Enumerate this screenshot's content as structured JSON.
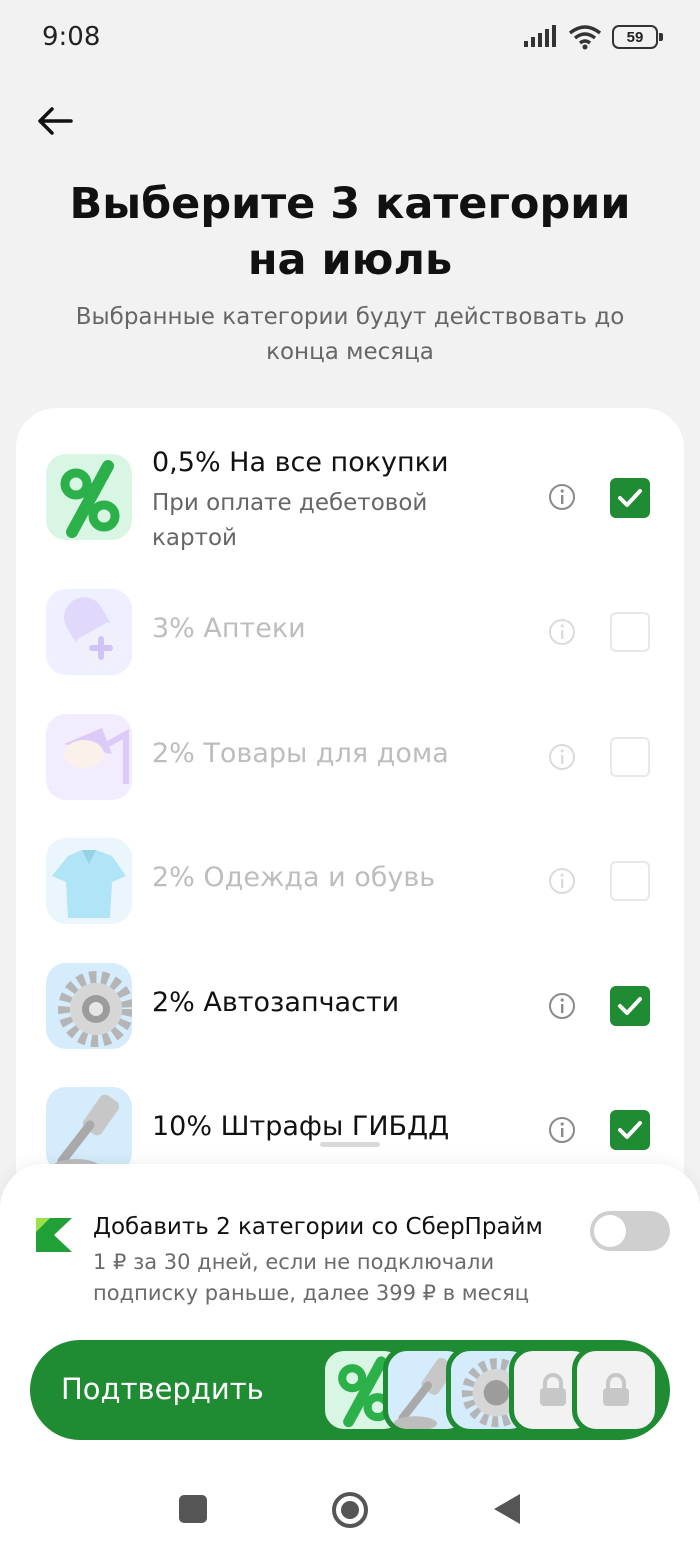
{
  "status": {
    "time": "9:08",
    "battery": "59"
  },
  "header": {
    "title_line1": "Выберите 3 категории",
    "title_line2": "на июль",
    "subtitle": "Выбранные категории будут действовать до конца месяца"
  },
  "categories": [
    {
      "label": "0,5% На все покупки",
      "sub": "При оплате дебетовой картой",
      "checked": true,
      "icon": "percent-icon"
    },
    {
      "label": "3% Аптеки",
      "checked": false,
      "icon": "pill-icon"
    },
    {
      "label": "2% Товары для дома",
      "checked": false,
      "icon": "lamp-icon"
    },
    {
      "label": "2% Одежда и обувь",
      "checked": false,
      "icon": "shirt-icon"
    },
    {
      "label": "2% Автозапчасти",
      "checked": true,
      "icon": "gear-icon"
    },
    {
      "label": "10% Штрафы ГИБДД",
      "checked": true,
      "icon": "gavel-icon"
    }
  ],
  "prime": {
    "title": "Добавить 2 категории со СберПрайм",
    "description": "1 ₽ за 30 дней, если не подключали подписку раньше, далее 399 ₽ в месяц",
    "enabled": false
  },
  "confirm": {
    "label": "Подтвердить"
  },
  "colors": {
    "accent": "#1f8b32",
    "background": "#f2f2f2"
  }
}
